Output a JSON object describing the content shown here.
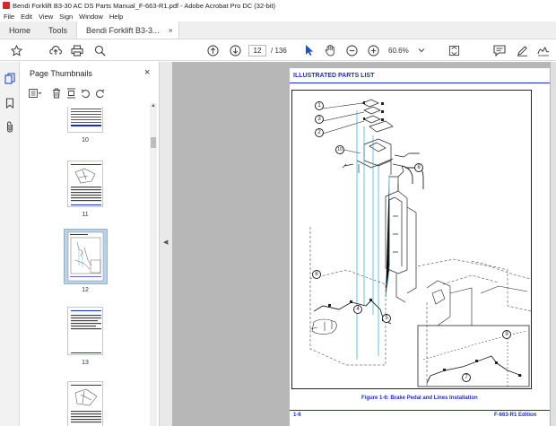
{
  "window": {
    "title": "Bendi Forklift B3-30 AC DS Parts Manual_F-663-R1.pdf - Adobe Acrobat Pro DC (32-bit)"
  },
  "menu": [
    "File",
    "Edit",
    "View",
    "Sign",
    "Window",
    "Help"
  ],
  "tabs": {
    "home": "Home",
    "tools": "Tools",
    "document": "Bendi Forklift B3-3...",
    "close_symbol": "×"
  },
  "toolbar": {
    "page_current": "12",
    "page_total": "/ 136",
    "zoom": "60.6%"
  },
  "panel": {
    "title": "Page Thumbnails",
    "close_symbol": "×",
    "thumbnails": [
      {
        "label": "10"
      },
      {
        "label": "11"
      },
      {
        "label": "12",
        "selected": true
      },
      {
        "label": "13"
      }
    ]
  },
  "document": {
    "header": "ILLUSTRATED PARTS LIST",
    "caption": "Figure 1-6:  Brake Pedal and Lines Installation",
    "footer_left": "1-6",
    "footer_right": "F-663-R1 Edition",
    "callouts": [
      "1",
      "3",
      "2",
      "10",
      "8",
      "6",
      "4",
      "5",
      "7",
      "9"
    ]
  },
  "colors": {
    "accent": "#1f2ad6",
    "selection": "#b7d2ea",
    "viewer_bg": "#b7b7b7",
    "tab_bar": "#efefef"
  }
}
